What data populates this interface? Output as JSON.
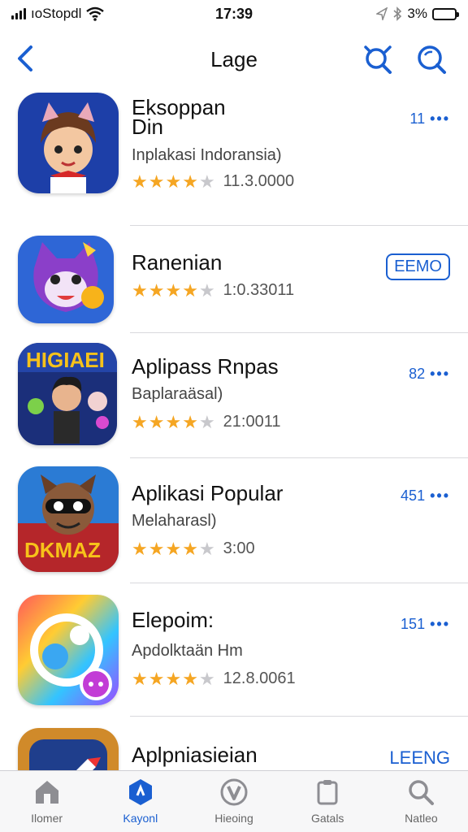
{
  "status_bar": {
    "carrier": "ıoStopdl",
    "time": "17:39",
    "battery_percent": "3%",
    "battery_level": 0.8
  },
  "nav": {
    "title": "Lage",
    "back_icon": "chevron-left-icon",
    "icon_a": "search-cancel-icon",
    "icon_b": "search-icon"
  },
  "apps": [
    {
      "name": "Eksoppan Din",
      "subtitle": "Inplakasi Indoransia)",
      "rating": 4,
      "count": "11.3.0000",
      "action": "11",
      "action_style": "dots",
      "icon": "cat-girl-icon"
    },
    {
      "name": "Ranenian",
      "subtitle": "",
      "rating": 4,
      "count": "1:0.33011",
      "action": "EEMO",
      "action_style": "button",
      "icon": "purple-cat-icon"
    },
    {
      "name": "Aplipass Rnpas",
      "subtitle": "Baplaraäsal)",
      "rating": 4,
      "count": "21:0011",
      "action": "82",
      "action_style": "dots",
      "icon": "kids-game-icon"
    },
    {
      "name": "Aplikasi Popular",
      "subtitle": "Melaharasl)",
      "rating": 4,
      "count": "3:00",
      "action": "451",
      "action_style": "dots",
      "icon": "masked-character-icon"
    },
    {
      "name": "Elepoim:",
      "subtitle": "Apdolktaän Hm",
      "rating": 4,
      "count": "12.8.0061",
      "action": "151",
      "action_style": "dots",
      "icon": "chat-swirl-icon"
    },
    {
      "name": "Aplpniasieian",
      "subtitle": "",
      "rating": 0,
      "count": "",
      "action": "LEENG",
      "action_style": "text",
      "icon": "pencil-app-icon"
    }
  ],
  "tabs": [
    {
      "label": "Ilomer",
      "icon": "home-icon",
      "active": false
    },
    {
      "label": "Kayonl",
      "icon": "hexagon-icon",
      "active": true
    },
    {
      "label": "Hieoing",
      "icon": "v-circle-icon",
      "active": false
    },
    {
      "label": "Gatals",
      "icon": "clipboard-icon",
      "active": false
    },
    {
      "label": "Natleo",
      "icon": "search-icon",
      "active": false
    }
  ],
  "colors": {
    "accent": "#1a5fd1",
    "star": "#f5a623"
  }
}
